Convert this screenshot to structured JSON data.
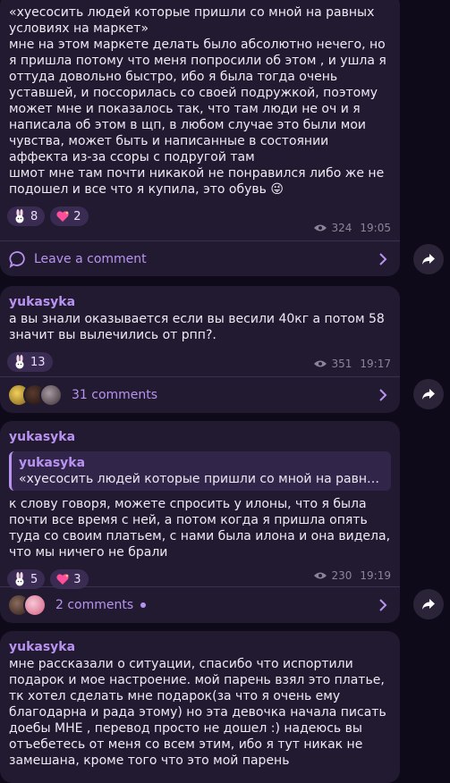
{
  "posts": [
    {
      "text": "«хуесосить людей которые пришли со мной на равных условиях на маркет»\nмне на этом маркете делать было абсолютно нечего, но я пришла потому что меня попросили об этом , и ушла я оттуда довольно быстро, ибо я была тогда очень уставшей, и поссорилась со своей подружкой, поэтому может мне и показалось так, что там люди не оч и я написала об этом в щп, в любом случае это были мои чувства, может быть и написанные в состоянии аффекта из-за ссоры с подругой там\nшмот мне там почти никакой не понравился либо же не подошел и все что я купила, это обувь 😜",
      "reactions": [
        {
          "icon": "bunny-icon",
          "count": "8"
        },
        {
          "icon": "sparkling-heart-icon",
          "count": "2"
        }
      ],
      "views": "324",
      "time": "19:05",
      "comments_label": "Leave a comment"
    },
    {
      "author": "yukasyka",
      "text": "а вы знали оказывается если вы весили 40кг а потом 58 значит вы вылечились от рпп?.",
      "reactions": [
        {
          "icon": "bunny-icon",
          "count": "13"
        }
      ],
      "views": "351",
      "time": "19:17",
      "comments_label": "31 comments"
    },
    {
      "author": "yukasyka",
      "quote_author": "yukasyka",
      "quote_text": "«хуесосить людей которые пришли со мной на равных у…",
      "text": "к слову говоря, можете спросить у илоны, что я была почти все время с ней, а потом когда я пришла опять туда со своим платьем, с нами была илона и она видела, что мы ничего не брали",
      "reactions": [
        {
          "icon": "bunny-icon",
          "count": "5"
        },
        {
          "icon": "sparkling-heart-icon",
          "count": "3"
        }
      ],
      "views": "230",
      "time": "19:19",
      "comments_label": "2 comments"
    },
    {
      "author": "yukasyka",
      "text": "мне рассказали о ситуации, спасибо что испортили подарок и мое настроение. мой парень взял это платье, тк хотел сделать мне подарок(за что я очень ему благодарна и рада этому) но эта девочка начала писать доебы МНЕ , перевод просто не дошел :) надеюсь вы отъебетесь от меня со всем этим, ибо я тут никак не замешана, кроме того что это мой парень"
    }
  ],
  "colors": {
    "accent": "#b993f0",
    "bubble": "#221a30",
    "background": "#0f0a1a"
  }
}
